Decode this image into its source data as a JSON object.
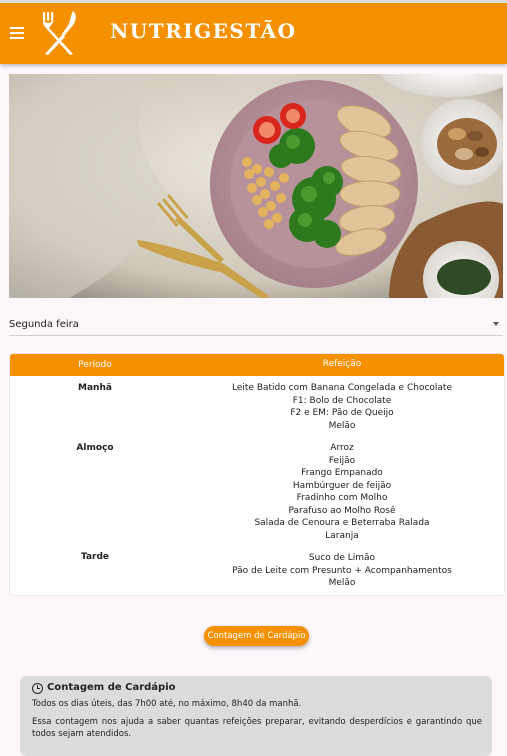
{
  "header": {
    "app_title": "NUTRIGESTÃO",
    "menu_icon": "hamburger-menu-icon",
    "logo_icon": "fork-knife-icon",
    "brand_color": "#f59100"
  },
  "hero": {
    "image": "plate-with-chicken-broccoli-chickpeas-tomatoes"
  },
  "day_select": {
    "value": "Segunda feira"
  },
  "table": {
    "headers": {
      "period": "Período",
      "meal": "Refeição"
    },
    "rows": [
      {
        "period": "Manhã",
        "items": [
          "Leite Batido com Banana Congelada e Chocolate",
          "F1: Bolo de Chocolate",
          "F2 e EM: Pão de Queijo",
          "Melão"
        ]
      },
      {
        "period": "Almoço",
        "items": [
          "Arroz",
          "Feijão",
          "Frango Empanado",
          "Hambúrguer de feijão",
          "Fradinho com Molho",
          "Parafuso ao Molho Rosê",
          "Salada de Cenoura e Beterraba Ralada",
          "Laranja"
        ]
      },
      {
        "period": "Tarde",
        "items": [
          "Suco de Limão",
          "Pão de Leite com Presunto + Acompanhamentos",
          "Melão"
        ]
      }
    ]
  },
  "actions": {
    "count_button": "Contagem de Cardápio"
  },
  "info": {
    "title": "Contagem de Cardápio",
    "line1": "Todos os dias úteis, das 7h00 até, no máximo, 8h40 da manhã.",
    "line2": "Essa contagem nos ajuda a saber quantas refeições preparar, evitando desperdícios e garantindo que todos sejam atendidos."
  }
}
